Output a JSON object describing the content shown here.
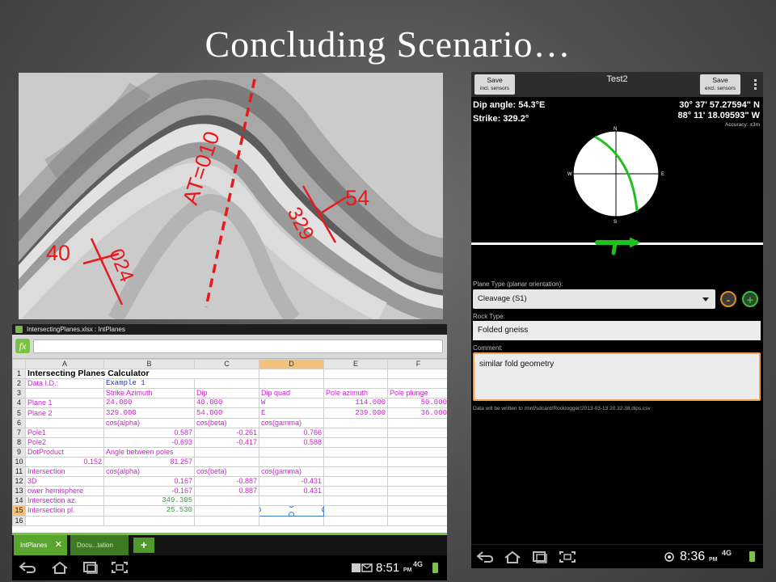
{
  "slide": {
    "title": "Concluding  Scenario…"
  },
  "photo": {
    "annotations": {
      "axial_trace": "AT=010",
      "left_dip": "40",
      "left_strike": "024",
      "right_dip": "54",
      "right_strike": "329"
    }
  },
  "spreadsheet": {
    "window_title": "IntersectingPlanes.xlsx : IntPlanes",
    "fx_label": "fx",
    "columns": [
      "A",
      "B",
      "C",
      "D",
      "E",
      "F"
    ],
    "rows": [
      {
        "num": "1",
        "a": "Intersecting Planes Calculator",
        "b": "",
        "c": "",
        "d": "",
        "e": "",
        "f": ""
      },
      {
        "num": "2",
        "a": "Data I.D.:",
        "b": "Example 1",
        "c": "",
        "d": "",
        "e": "",
        "f": ""
      },
      {
        "num": "3",
        "a": "",
        "b": "Strike Azimuth",
        "c": "Dip",
        "d": "Dip quad",
        "e": "Pole azimuth",
        "f": "Pole plunge"
      },
      {
        "num": "4",
        "a": "Plane 1",
        "b": "24.000",
        "c": "40.000",
        "d": "W",
        "e": "114.000",
        "f": "50.000"
      },
      {
        "num": "5",
        "a": "Plane 2",
        "b": "329.000",
        "c": "54.000",
        "d": "E",
        "e": "239.000",
        "f": "36.000"
      },
      {
        "num": "6",
        "a": "",
        "b": "cos(alpha)",
        "c": "cos(beta)",
        "d": "cos(gamma)",
        "e": "",
        "f": ""
      },
      {
        "num": "7",
        "a": "Pole1",
        "b": "0.587",
        "c": "-0.261",
        "d": "0.766",
        "e": "",
        "f": ""
      },
      {
        "num": "8",
        "a": "Pole2",
        "b": "-0.693",
        "c": "-0.417",
        "d": "0.588",
        "e": "",
        "f": ""
      },
      {
        "num": "9",
        "a": "DotProduct",
        "b": "Angle between poles",
        "c": "",
        "d": "",
        "e": "",
        "f": ""
      },
      {
        "num": "10",
        "a": "0.152",
        "b": "81.257",
        "c": "",
        "d": "",
        "e": "",
        "f": ""
      },
      {
        "num": "11",
        "a": "Intersection",
        "b": "cos(alpha)",
        "c": "cos(beta)",
        "d": "cos(gamma)",
        "e": "",
        "f": ""
      },
      {
        "num": "12",
        "a": "3D",
        "b": "0.167",
        "c": "-0.887",
        "d": "-0.431",
        "e": "",
        "f": ""
      },
      {
        "num": "13",
        "a": "ower hemisphere",
        "b": "-0.167",
        "c": "0.887",
        "d": "0.431",
        "e": "",
        "f": ""
      },
      {
        "num": "14",
        "a": "Intersection az.",
        "b": "349.305",
        "c": "",
        "d": "",
        "e": "",
        "f": ""
      },
      {
        "num": "15",
        "a": "Intersection pl.",
        "b": "25.530",
        "c": "",
        "d": "",
        "e": "",
        "f": ""
      },
      {
        "num": "16",
        "a": "",
        "b": "",
        "c": "",
        "d": "",
        "e": "",
        "f": ""
      }
    ],
    "tabs": {
      "active": "IntPlanes",
      "inactive": "Docu...tation",
      "add": "+"
    },
    "status": {
      "clock": "8:51",
      "ampm": "PM",
      "network": "4G"
    }
  },
  "phone": {
    "save_incl_label": "Save",
    "save_incl_sub": "incl. sensors",
    "save_excl_label": "Save",
    "save_excl_sub": "excl. sensors",
    "title": "Test2",
    "dip_angle": "Dip angle: 54.3°E",
    "strike": "Strike: 329.2°",
    "latitude": "30° 37' 57.27594\" N",
    "longitude": "88° 11' 18.09593\" W",
    "accuracy": "Accuracy: ±3m",
    "compass": {
      "n": "N",
      "s": "S",
      "e": "E",
      "w": "W"
    },
    "plane_type_label": "Plane Type (planar orientation):",
    "plane_type_value": "Cleavage (S1)",
    "minus": "-",
    "plus": "+",
    "rock_type_label": "Rock Type:",
    "rock_type_value": "Folded gneiss",
    "comment_label": "Comment:",
    "comment_value": "similar fold geometry",
    "data_note": "Data will be written to /mnt/sdcard/Rocklogger/2013-03-13 20.32.38.dips.csv",
    "clock": "8:36",
    "ampm": "PM",
    "network": "4G"
  },
  "colors": {
    "annotation_red": "#e8191b",
    "accent_green": "#7cc242",
    "pink_text": "#cc22cc",
    "comment_border": "#f0a050"
  }
}
